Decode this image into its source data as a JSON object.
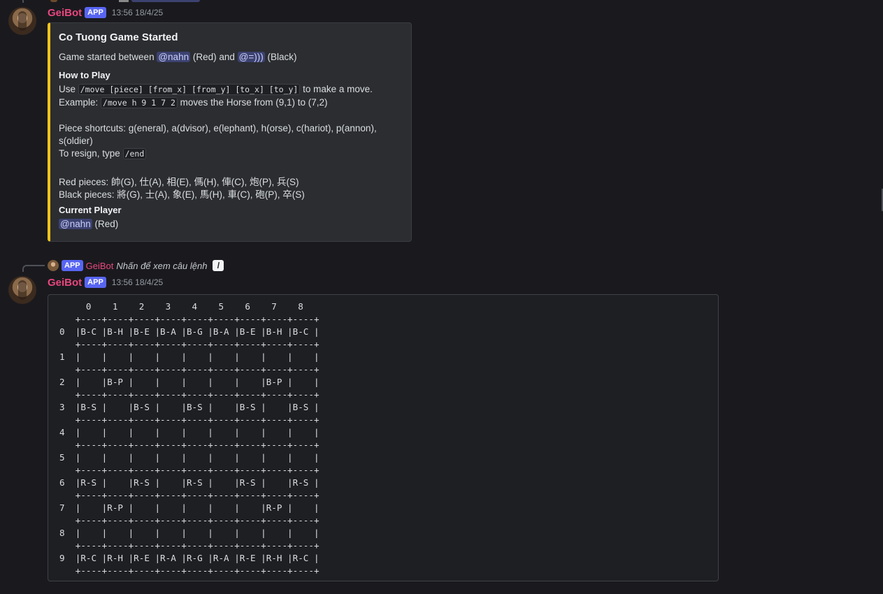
{
  "message1": {
    "username": "GeiBot",
    "badge": "APP",
    "timestamp": "13:56 18/4/25",
    "embed": {
      "title": "Co Tuong Game Started",
      "desc_prefix": "Game started between",
      "mention_red": "@nahn",
      "red_suffix": "(Red) and",
      "mention_black": "@=)))",
      "black_suffix": "(Black)",
      "how_to_play_title": "How to Play",
      "use_prefix": "Use",
      "move_syntax": "/move [piece] [from_x] [from_y] [to_x] [to_y]",
      "use_suffix": "to make a move.",
      "example_prefix": "Example:",
      "example_code": "/move h 9 1 7 2",
      "example_suffix": "moves the Horse from (9,1) to (7,2)",
      "shortcuts_line1": "Piece shortcuts: g(eneral), a(dvisor), e(lephant), h(orse), c(hariot), p(annon),",
      "shortcuts_line2": "s(oldier)",
      "resign_prefix": "To resign, type",
      "resign_code": "/end",
      "red_pieces": "Red pieces: 帥(G), 仕(A), 相(E), 傌(H), 俥(C), 炮(P), 兵(S)",
      "black_pieces": "Black pieces: 將(G), 士(A), 象(E), 馬(H), 車(C), 砲(P), 卒(S)",
      "current_player_title": "Current Player",
      "current_player_mention": "@nahn",
      "current_player_suffix": "(Red)",
      "accent_color": "#f0c419"
    }
  },
  "reply": {
    "badge": "APP",
    "username": "GeiBot",
    "text": "Nhấn để xem câu lệnh",
    "icon": "slash-command-icon"
  },
  "message2": {
    "username": "GeiBot",
    "badge": "APP",
    "timestamp": "13:56 18/4/25",
    "board": {
      "header": "     0    1    2    3    4    5    6    7    8",
      "separator": "   +----+----+----+----+----+----+----+----+----+",
      "rows": [
        "0  |B-C |B-H |B-E |B-A |B-G |B-A |B-E |B-H |B-C |",
        "1  |    |    |    |    |    |    |    |    |    |",
        "2  |    |B-P |    |    |    |    |    |B-P |    |",
        "3  |B-S |    |B-S |    |B-S |    |B-S |    |B-S |",
        "4  |    |    |    |    |    |    |    |    |    |",
        "5  |    |    |    |    |    |    |    |    |    |",
        "6  |R-S |    |R-S |    |R-S |    |R-S |    |R-S |",
        "7  |    |R-P |    |    |    |    |    |R-P |    |",
        "8  |    |    |    |    |    |    |    |    |    |",
        "9  |R-C |R-H |R-E |R-A |R-G |R-A |R-E |R-H |R-C |"
      ]
    }
  },
  "colors": {
    "background": "#1a1a1e",
    "username": "#e8477e",
    "badge": "#5865f2",
    "mention_bg": "#3c4270"
  }
}
